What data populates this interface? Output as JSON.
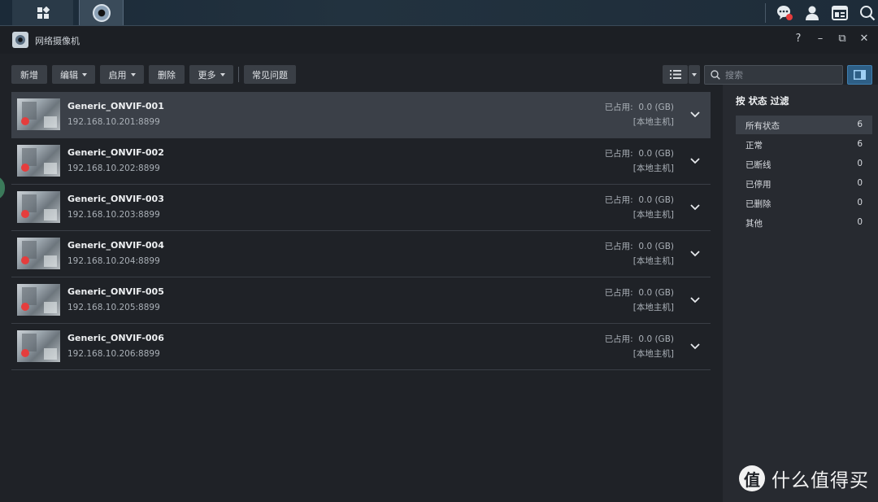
{
  "taskbar": {
    "colors": {
      "bg": "#1e2c39",
      "notify_dot": "#e53d3d"
    }
  },
  "window": {
    "title": "网络摄像机",
    "controls": {
      "help": "?",
      "minimize": "–",
      "restore": "⧉",
      "close": "✕"
    }
  },
  "toolbar": {
    "add": "新增",
    "edit": "编辑",
    "enable": "启用",
    "delete": "删除",
    "more": "更多",
    "faq": "常见问题",
    "search_placeholder": "搜索"
  },
  "cameras": [
    {
      "name": "Generic_ONVIF-001",
      "ip": "192.168.10.201:8899",
      "usage_label": "已占用:",
      "usage_value": "0.0 (GB)",
      "host": "[本地主机]",
      "selected": true
    },
    {
      "name": "Generic_ONVIF-002",
      "ip": "192.168.10.202:8899",
      "usage_label": "已占用:",
      "usage_value": "0.0 (GB)",
      "host": "[本地主机]",
      "selected": false
    },
    {
      "name": "Generic_ONVIF-003",
      "ip": "192.168.10.203:8899",
      "usage_label": "已占用:",
      "usage_value": "0.0 (GB)",
      "host": "[本地主机]",
      "selected": false
    },
    {
      "name": "Generic_ONVIF-004",
      "ip": "192.168.10.204:8899",
      "usage_label": "已占用:",
      "usage_value": "0.0 (GB)",
      "host": "[本地主机]",
      "selected": false
    },
    {
      "name": "Generic_ONVIF-005",
      "ip": "192.168.10.205:8899",
      "usage_label": "已占用:",
      "usage_value": "0.0 (GB)",
      "host": "[本地主机]",
      "selected": false
    },
    {
      "name": "Generic_ONVIF-006",
      "ip": "192.168.10.206:8899",
      "usage_label": "已占用:",
      "usage_value": "0.0 (GB)",
      "host": "[本地主机]",
      "selected": false
    }
  ],
  "filter_panel": {
    "title": "按 状态 过滤",
    "items": [
      {
        "label": "所有状态",
        "count": "6",
        "active": true
      },
      {
        "label": "正常",
        "count": "6",
        "active": false
      },
      {
        "label": "已断线",
        "count": "0",
        "active": false
      },
      {
        "label": "已停用",
        "count": "0",
        "active": false
      },
      {
        "label": "已删除",
        "count": "0",
        "active": false
      },
      {
        "label": "其他",
        "count": "0",
        "active": false
      }
    ]
  },
  "watermark": {
    "logo": "值",
    "text": "什么值得买"
  },
  "colors": {
    "background": "#1f2227",
    "selected_row": "#3b4048",
    "accent": "#2e5f86",
    "record_dot": "#e53d3d"
  }
}
